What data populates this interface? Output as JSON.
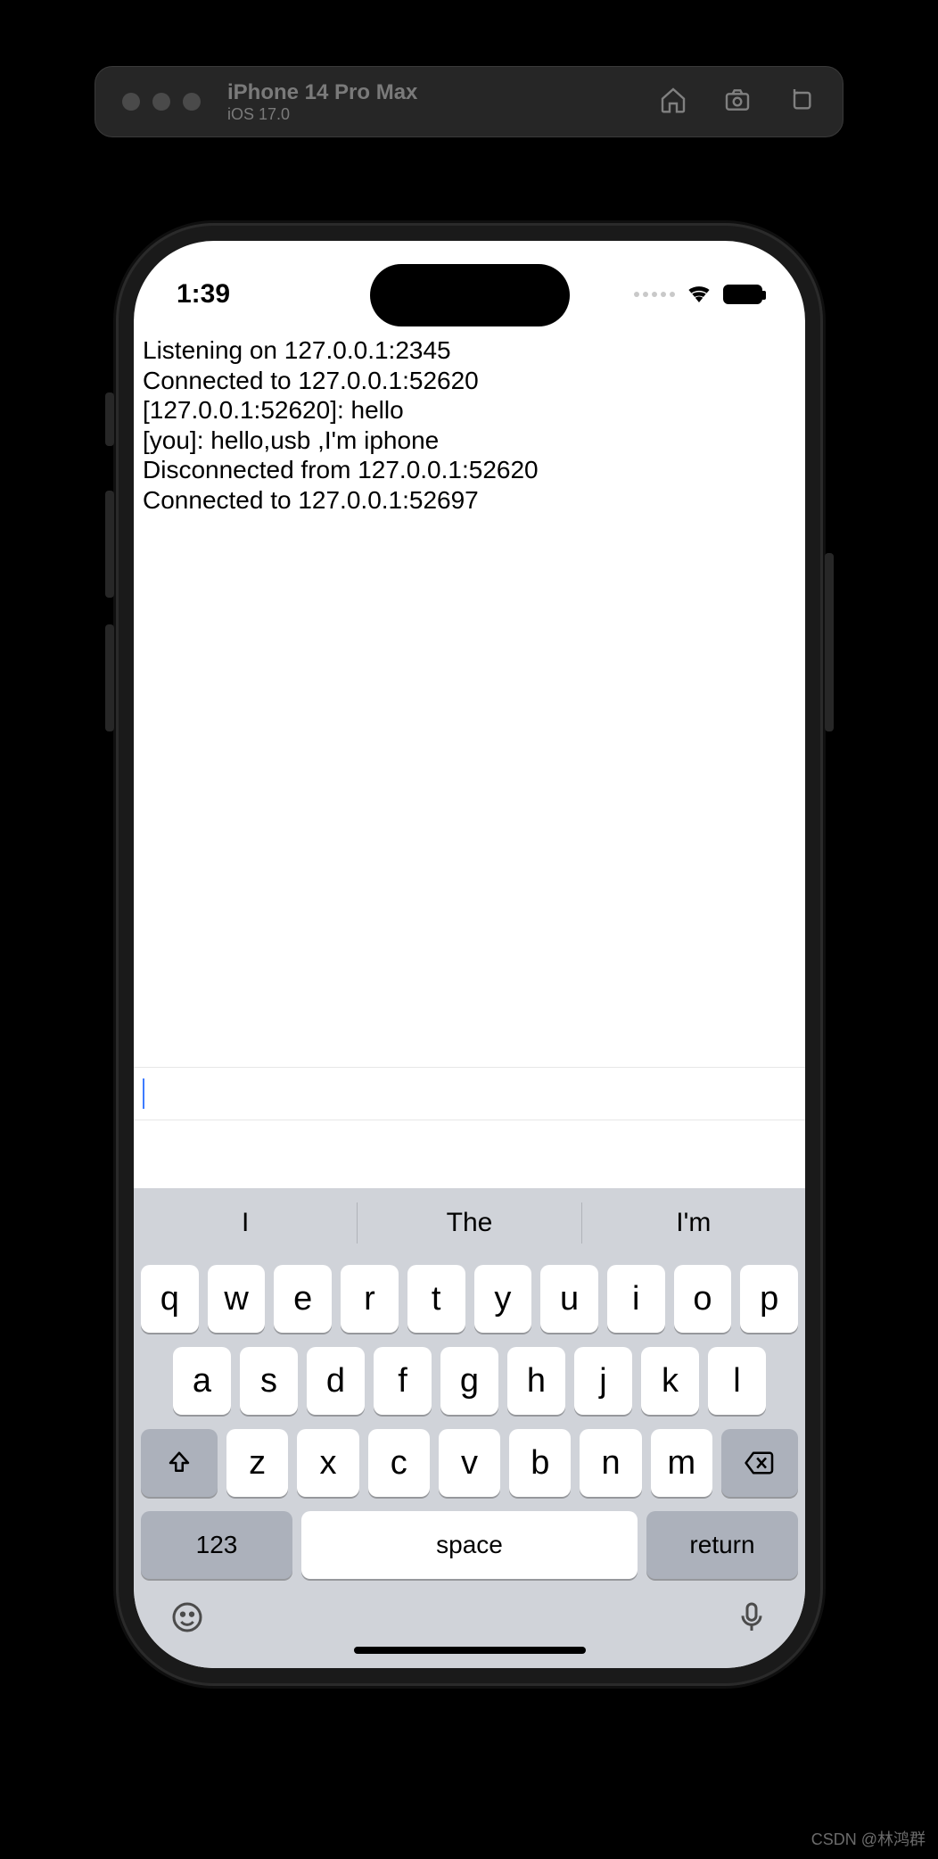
{
  "sim": {
    "title": "iPhone 14 Pro Max",
    "subtitle": "iOS 17.0"
  },
  "status": {
    "time": "1:39"
  },
  "log_lines": [
    "Listening on 127.0.0.1:2345",
    "Connected to 127.0.0.1:52620",
    "[127.0.0.1:52620]: hello",
    "[you]: hello,usb ,I'm iphone",
    "Disconnected from 127.0.0.1:52620",
    "Connected to 127.0.0.1:52697"
  ],
  "input": {
    "value": ""
  },
  "keyboard": {
    "suggestions": [
      "I",
      "The",
      "I'm"
    ],
    "row1": [
      "q",
      "w",
      "e",
      "r",
      "t",
      "y",
      "u",
      "i",
      "o",
      "p"
    ],
    "row2": [
      "a",
      "s",
      "d",
      "f",
      "g",
      "h",
      "j",
      "k",
      "l"
    ],
    "row3": [
      "z",
      "x",
      "c",
      "v",
      "b",
      "n",
      "m"
    ],
    "numeric_label": "123",
    "space_label": "space",
    "return_label": "return"
  },
  "watermark": "CSDN @林鸿群"
}
